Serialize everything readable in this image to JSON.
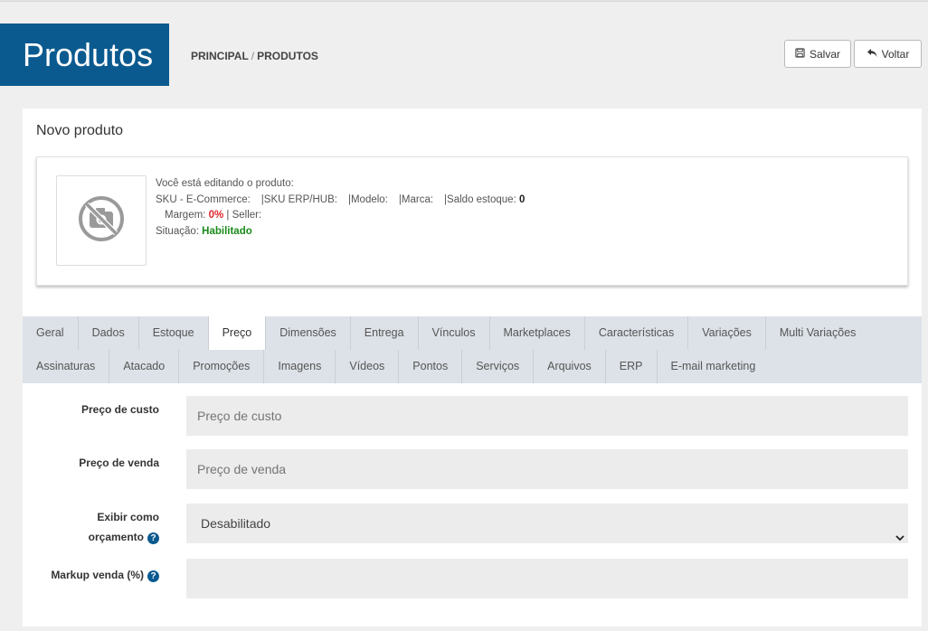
{
  "page": {
    "title": "Produtos",
    "breadcrumb": {
      "home": "PRINCIPAL",
      "separator": "/",
      "current": "PRODUTOS"
    }
  },
  "toolbar": {
    "save_label": "Salvar",
    "back_label": "Voltar"
  },
  "panel": {
    "title": "Novo produto"
  },
  "product_info": {
    "editing_label": "Você está editando o produto:",
    "sku_ecommerce_label": "SKU - E-Commerce:",
    "sku_erp_label": "SKU ERP/HUB:",
    "model_label": "Modelo:",
    "brand_label": "Marca:",
    "stock_label": "Saldo estoque:",
    "stock_value": "0",
    "margin_label": "Margem:",
    "margin_value": "0%",
    "seller_sep": "|",
    "seller_label": "Seller:",
    "status_label": "Situação:",
    "status_value": "Habilitado"
  },
  "tabs_row1": [
    "Geral",
    "Dados",
    "Estoque",
    "Preço",
    "Dimensões",
    "Entrega",
    "Vínculos",
    "Marketplaces",
    "Características",
    "Variações",
    "Multi Variações"
  ],
  "tabs_row2": [
    "Assinaturas",
    "Atacado",
    "Promoções",
    "Imagens",
    "Vídeos",
    "Pontos",
    "Serviços",
    "Arquivos",
    "ERP",
    "E-mail marketing"
  ],
  "active_tab": "Preço",
  "form": {
    "cost_price": {
      "label": "Preço de custo",
      "placeholder": "Preço de custo",
      "value": ""
    },
    "sale_price": {
      "label": "Preço de venda",
      "placeholder": "Preço de venda",
      "value": ""
    },
    "show_as_quote": {
      "label_line1": "Exibir como",
      "label_line2": "orçamento",
      "value": "Desabilitado"
    },
    "markup": {
      "label": "Markup venda (%)",
      "value": ""
    }
  },
  "colors": {
    "brand": "#0b5a8f",
    "danger": "#e0262c",
    "success": "#1a8a1a"
  }
}
